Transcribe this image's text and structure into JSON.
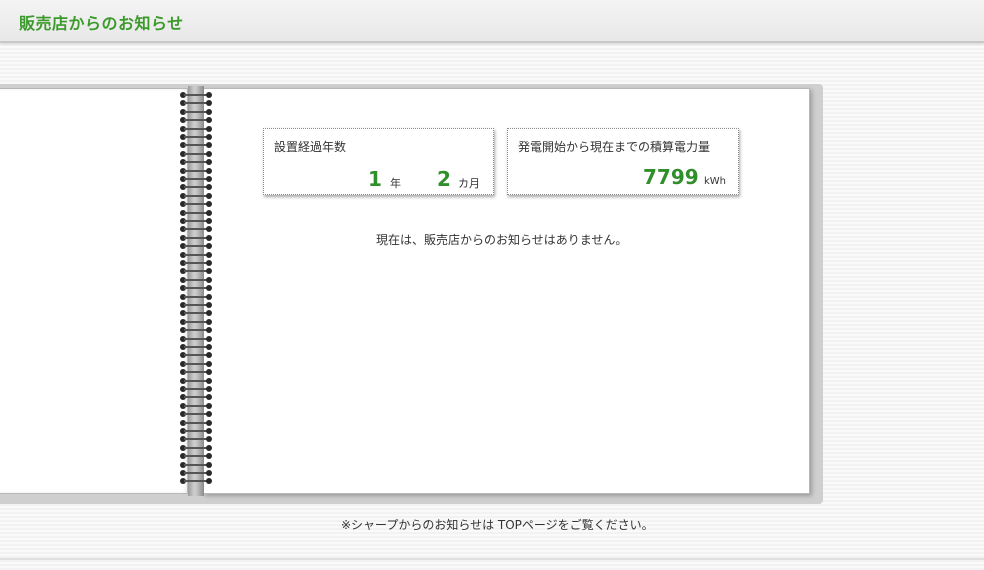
{
  "header": {
    "title": "販売店からのお知らせ"
  },
  "stats": {
    "years_label": "設置経過年数",
    "years_value": "1",
    "years_unit": "年",
    "months_value": "2",
    "months_unit": "カ月",
    "energy_label": "発電開始から現在までの積算電力量",
    "energy_value": "7799",
    "energy_unit": "kWh"
  },
  "notice": {
    "message": "現在は、販売店からのお知らせはありません。"
  },
  "footer": {
    "note": "※シャープからのお知らせは TOPページをご覧ください。"
  },
  "colors": {
    "accent": "#3c9a2c",
    "value_green": "#2f8f2a"
  }
}
